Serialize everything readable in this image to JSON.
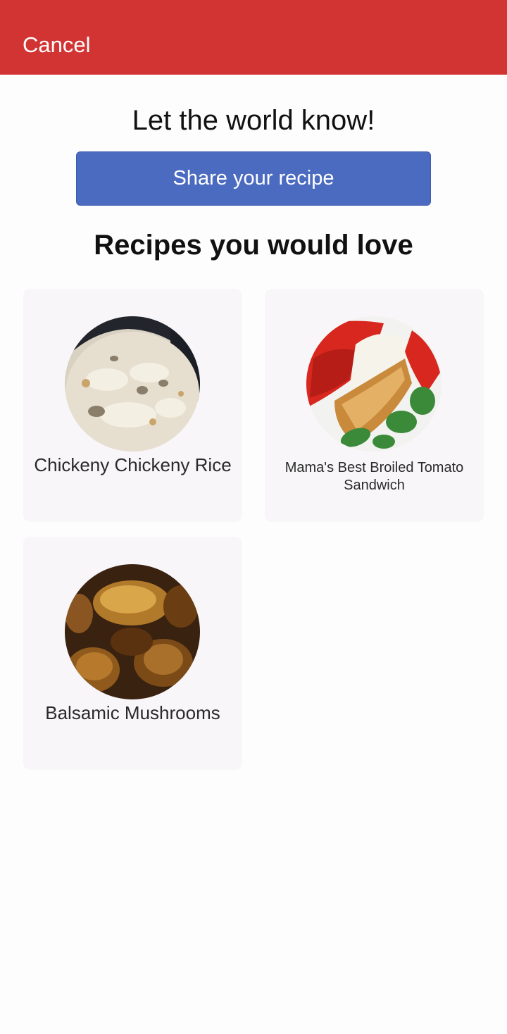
{
  "header": {
    "cancel_label": "Cancel",
    "background_color": "#d23434"
  },
  "share": {
    "headline": "Let the world know!",
    "button_label": "Share your recipe",
    "button_color": "#4b6bc0"
  },
  "recommendations": {
    "title": "Recipes you would love",
    "recipes": [
      {
        "name": "Chickeny Chickeny Rice",
        "image": "rice-dish"
      },
      {
        "name": "Mama's Best Broiled Tomato Sandwich",
        "image": "tomato-sandwich"
      },
      {
        "name": "Balsamic Mushrooms",
        "image": "mushrooms"
      }
    ]
  }
}
